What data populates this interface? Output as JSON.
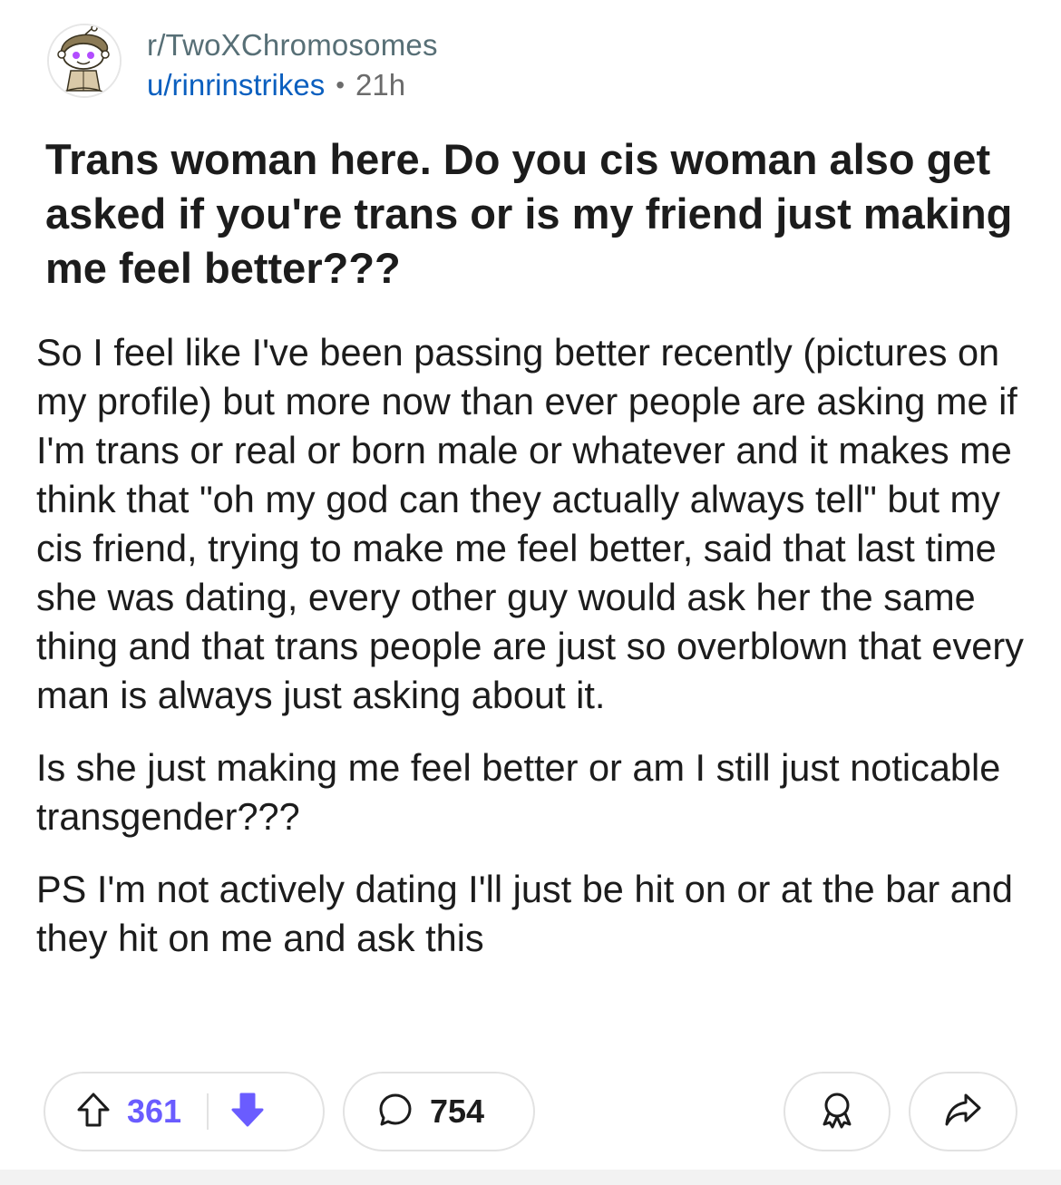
{
  "header": {
    "subreddit": "r/TwoXChromosomes",
    "username": "u/rinrinstrikes",
    "separator": "•",
    "time": "21h"
  },
  "post": {
    "title": "Trans woman here. Do you cis woman also get asked if you're trans or is my friend just making me feel better???",
    "body_lines": [
      "So I feel like I've been passing better recently (pictures on my profile) but more now than ever people are asking me if I'm trans or real or born male or whatever and it makes me think that \"oh my god can they actually always tell\"  but my cis friend, trying to make me feel better, said that last time she was dating, every other guy would ask her the same thing and that trans people are just so overblown that every man is always just asking about it.",
      "Is she just making me feel better or am I still just noticable transgender???",
      "PS I'm not actively dating I'll just be hit on or at the bar and they hit on me and ask this"
    ]
  },
  "actions": {
    "upvotes": "361",
    "comments": "754"
  },
  "colors": {
    "upvote_accent": "#6a5cff",
    "username": "#0a5fbf",
    "subreddit": "#576f76"
  },
  "icons": {
    "avatar": "snoo-avatar",
    "upvote": "arrow-up-icon",
    "downvote": "arrow-down-icon",
    "comment": "comment-bubble-icon",
    "award": "award-icon",
    "share": "share-icon"
  }
}
